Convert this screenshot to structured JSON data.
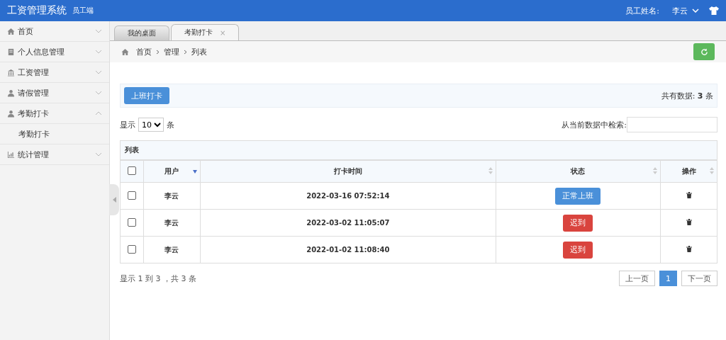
{
  "header": {
    "title": "工资管理系统",
    "subtitle": "员工端",
    "user_label": "员工姓名:",
    "user_name": "李云"
  },
  "sidebar": {
    "items": [
      {
        "label": "首页",
        "expanded": false
      },
      {
        "label": "个人信息管理",
        "expanded": false
      },
      {
        "label": "工资管理",
        "expanded": false
      },
      {
        "label": "请假管理",
        "expanded": false
      },
      {
        "label": "考勤打卡",
        "expanded": true,
        "children": [
          {
            "label": "考勤打卡"
          }
        ]
      },
      {
        "label": "统计管理",
        "expanded": false
      }
    ]
  },
  "tabs": [
    {
      "label": "我的桌面",
      "selected": false
    },
    {
      "label": "考勤打卡",
      "selected": true,
      "close": "×"
    }
  ],
  "breadcrumb": [
    "首页",
    "管理",
    "列表"
  ],
  "toolbar": {
    "button": "上班打卡",
    "total_label": "共有数据:",
    "total_count": "3",
    "total_unit": "条"
  },
  "length": {
    "prefix": "显示",
    "value": "10",
    "suffix": "条"
  },
  "search": {
    "label": "从当前数据中检索:"
  },
  "table": {
    "caption": "列表",
    "select_all_checked": false,
    "columns": [
      {
        "label": "用户",
        "kind": "sorted"
      },
      {
        "label": "打卡时间",
        "kind": "sortable"
      },
      {
        "label": "状态",
        "kind": "sortable"
      },
      {
        "label": "操作",
        "kind": "sortable"
      }
    ],
    "rows": [
      {
        "checked": false,
        "user": "李云",
        "time": "2022-03-16 07:52:14",
        "status": "正常上班",
        "kind": "normal"
      },
      {
        "checked": false,
        "user": "李云",
        "time": "2022-03-02 11:05:07",
        "status": "迟到",
        "kind": "late"
      },
      {
        "checked": false,
        "user": "李云",
        "time": "2022-01-02 11:08:40",
        "status": "迟到",
        "kind": "late"
      }
    ]
  },
  "info": "显示 1 到 3 ，共 3 条",
  "pagination": {
    "prev": "上一页",
    "pages": [
      {
        "label": "1",
        "selected": true
      }
    ],
    "next": "下一页"
  }
}
